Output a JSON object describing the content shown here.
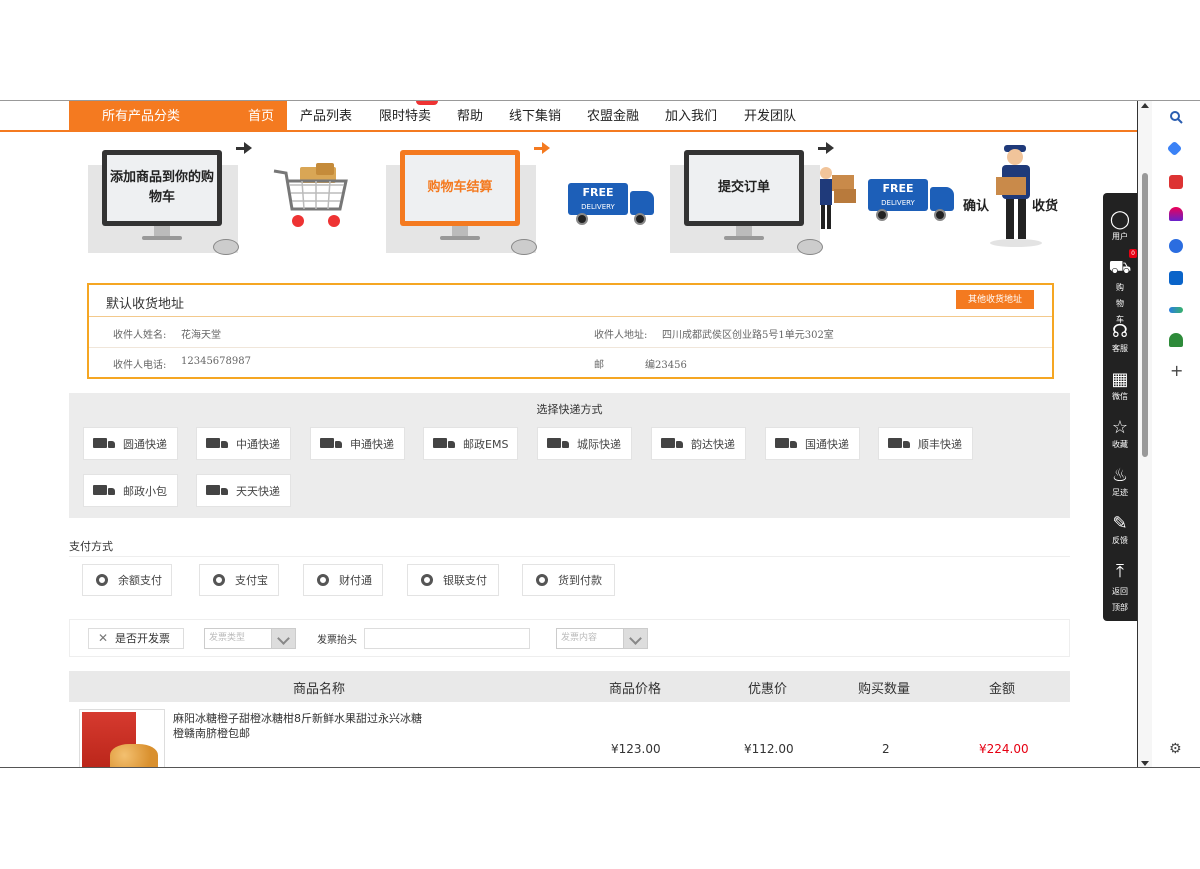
{
  "nav": {
    "category": "所有产品分类",
    "items": [
      "首页",
      "产品列表",
      "限时特卖",
      "帮助",
      "线下集销",
      "农盟金融",
      "加入我们",
      "开发团队"
    ]
  },
  "steps": {
    "step1": "添加商品到你的购物车",
    "step2": "购物车结算",
    "step3": "提交订单",
    "step4a": "确认",
    "step4b": "收货",
    "truck_text": "FREE",
    "truck_sub": "DELIVERY"
  },
  "address": {
    "title": "默认收货地址",
    "other_button": "其他收货地址",
    "name_label": "收件人姓名:",
    "name_value": "花海天堂",
    "addr_label": "收件人地址:",
    "addr_value": "四川成都武侯区创业路5号1单元302室",
    "phone_label": "收件人电话:",
    "phone_value": "12345678987",
    "zip_label": "邮",
    "zip_value": "编23456"
  },
  "express": {
    "title": "选择快递方式",
    "options": [
      "圆通快递",
      "中通快递",
      "申通快递",
      "邮政EMS",
      "城际快递",
      "韵达快递",
      "国通快递",
      "顺丰快递",
      "邮政小包",
      "天天快递"
    ]
  },
  "payment": {
    "title": "支付方式",
    "options": [
      "余额支付",
      "支付宝",
      "财付通",
      "银联支付",
      "货到付款"
    ]
  },
  "invoice": {
    "checkbox_label": "是否开发票",
    "type_placeholder": "发票类型",
    "header_label": "发票抬头",
    "content_placeholder": "发票内容"
  },
  "table": {
    "headers": [
      "商品名称",
      "商品价格",
      "优惠价",
      "购买数量",
      "金额"
    ],
    "rows": [
      {
        "name": "麻阳冰糖橙子甜橙冰糖柑8斤新鲜水果甜过永兴冰糖橙赣南脐橙包邮",
        "price": "¥123.00",
        "discount": "¥112.00",
        "qty": "2",
        "amount": "¥224.00"
      }
    ]
  },
  "float_toolbar": {
    "items": [
      "用户",
      "购物车",
      "客服",
      "微信",
      "收藏",
      "足迹",
      "反馈",
      "返回顶部"
    ],
    "cart_badge": "0"
  }
}
